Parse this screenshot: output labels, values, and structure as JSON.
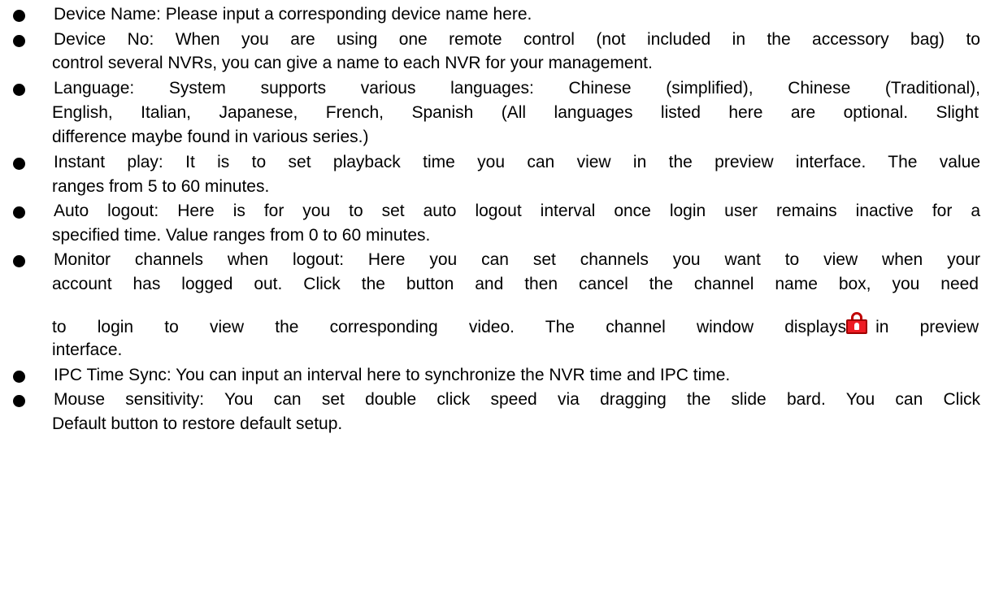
{
  "items": [
    {
      "lines": [
        "Device Name: Please input a corresponding device name here."
      ]
    },
    {
      "lines": [
        "Device No: When you are using one remote control (not included in the accessory bag) to",
        "control several NVRs, you can give a name to each NVR for your management."
      ]
    },
    {
      "lines": [
        "Language: System supports various languages: Chinese (simplified), Chinese (Traditional),",
        "English, Italian, Japanese, French, Spanish (All languages listed here are optional. Slight",
        "difference maybe found in various series.)"
      ]
    },
    {
      "lines": [
        "Instant play: It is to set playback time you can view in the preview interface. The value",
        "ranges from 5 to 60 minutes."
      ]
    },
    {
      "lines": [
        "Auto logout: Here is for you to set auto logout interval once login user remains inactive for a",
        "specified time. Value ranges from 0 to 60 minutes."
      ]
    },
    {
      "lines": [
        "Monitor channels when logout: Here you can set channels you want to view when your",
        "account has logged out. Click the button and then cancel the channel name box, you need"
      ],
      "icon_line_before": "to login to view the corresponding video. The channel window displays",
      "icon_line_after": "in preview",
      "icon": "lock-icon",
      "last_line": "interface."
    },
    {
      "lines": [
        "IPC Time Sync: You can input an interval here to synchronize the NVR time and IPC time."
      ]
    },
    {
      "lines": [
        "Mouse sensitivity: You can set double click speed via dragging the slide bard. You can Click",
        "Default button to restore default setup."
      ]
    }
  ],
  "colors": {
    "text": "#000000",
    "lock_icon": "#ee1c24"
  }
}
